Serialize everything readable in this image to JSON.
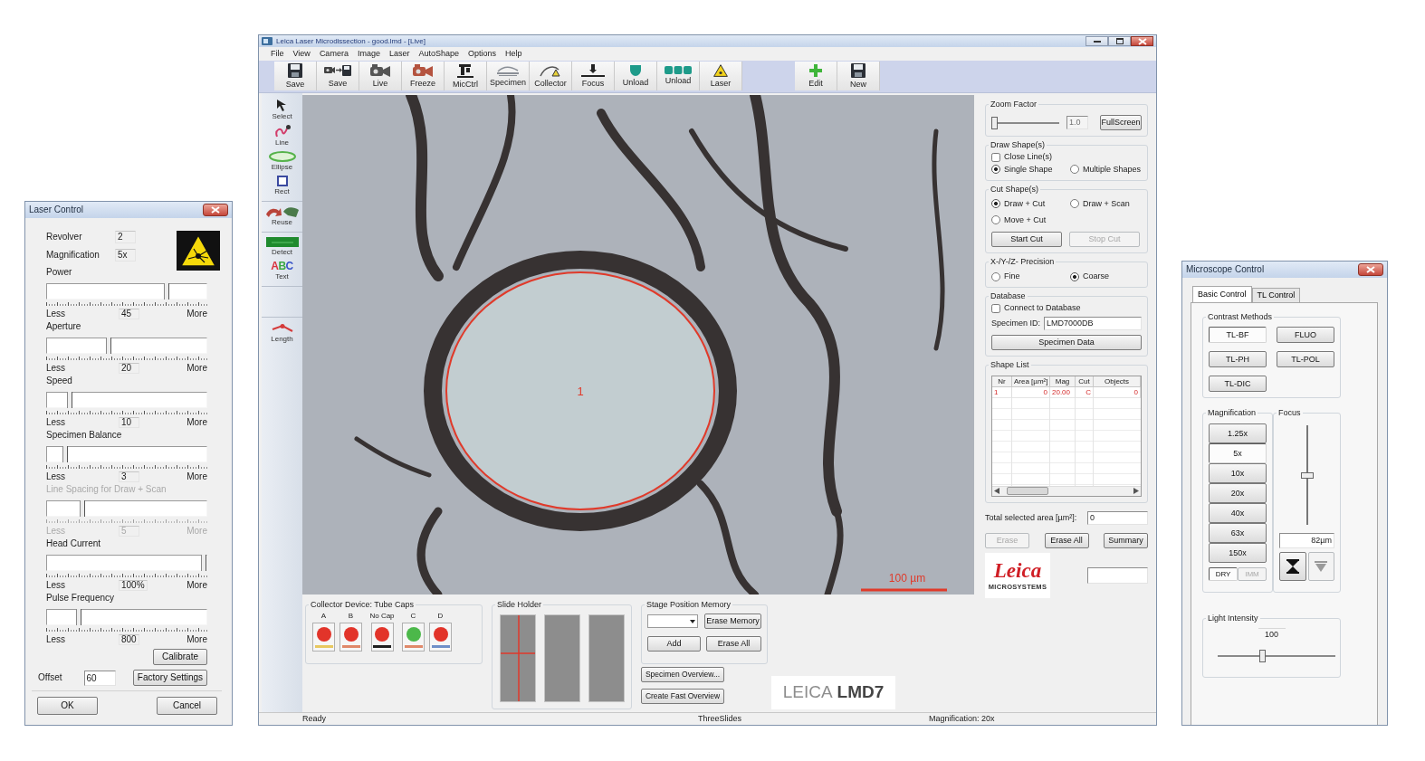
{
  "laser_control": {
    "title": "Laser Control",
    "revolver": {
      "label": "Revolver",
      "value": "2"
    },
    "magnification": {
      "label": "Magnification",
      "value": "5x"
    },
    "sliders": [
      {
        "title": "Power",
        "level": 0.76,
        "value": "45",
        "less": "Less",
        "more": "More",
        "disabled": false
      },
      {
        "title": "Aperture",
        "level": 0.38,
        "value": "20",
        "less": "Less",
        "more": "More",
        "disabled": false
      },
      {
        "title": "Speed",
        "level": 0.13,
        "value": "10",
        "less": "Less",
        "more": "More",
        "disabled": false
      },
      {
        "title": "Specimen Balance",
        "level": 0.1,
        "value": "3",
        "less": "Less",
        "more": "More",
        "disabled": false
      },
      {
        "title": "Line Spacing for Draw + Scan",
        "level": 0.21,
        "value": "5",
        "less": "Less",
        "more": "More",
        "disabled": true
      },
      {
        "title": "Head Current",
        "level": 1,
        "value": "100%",
        "less": "Less",
        "more": "More",
        "disabled": false
      },
      {
        "title": "Pulse Frequency",
        "level": 0.19,
        "value": "800",
        "less": "Less",
        "more": "More",
        "disabled": false
      }
    ],
    "calibrate_button": "Calibrate",
    "offset": {
      "label": "Offset",
      "value": "60"
    },
    "factory_settings_button": "Factory Settings",
    "ok_button": "OK",
    "cancel_button": "Cancel"
  },
  "main_window": {
    "title": "Leica Laser Microdissection - good.lmd - [Live]",
    "menu": [
      "File",
      "View",
      "Camera",
      "Image",
      "Laser",
      "AutoShape",
      "Options",
      "Help"
    ],
    "toolbar_groups": [
      [
        "Save",
        "Save",
        "Live",
        "Freeze",
        "MicCtrl",
        "Specimen",
        "Collector",
        "Focus",
        "Unload",
        "Unload",
        "Laser"
      ],
      [
        "Edit",
        "New"
      ]
    ],
    "tool_groups": [
      [
        {
          "label": "Select"
        },
        {
          "label": "Line"
        },
        {
          "label": "Ellipse"
        },
        {
          "label": "Rect"
        }
      ],
      [
        {
          "label": "Reuse"
        }
      ],
      [
        {
          "label": "Detect"
        },
        {
          "label": "Text",
          "glyph": "ABC"
        }
      ],
      [
        {
          "label": "Length"
        }
      ]
    ],
    "image": {
      "shape_number": "1",
      "scale_bar": "100 µm"
    },
    "zoom_factor": {
      "title": "Zoom Factor",
      "level": 0,
      "value": "1.0",
      "button": "FullScreen"
    },
    "draw_shapes": {
      "title": "Draw Shape(s)",
      "close_lines": {
        "label": "Close Line(s)",
        "checked": false
      },
      "modes": [
        {
          "label": "Single Shape",
          "selected": true
        },
        {
          "label": "Multiple Shapes",
          "selected": false
        }
      ]
    },
    "cut_shapes": {
      "title": "Cut Shape(s)",
      "modes": [
        {
          "label": "Draw + Cut",
          "selected": true
        },
        {
          "label": "Draw + Scan",
          "selected": false
        },
        {
          "label": "Move + Cut",
          "selected": false
        }
      ],
      "buttons": [
        {
          "label": "Start Cut",
          "disabled": false
        },
        {
          "label": "Stop Cut",
          "disabled": true
        }
      ]
    },
    "precision": {
      "title": "X-/Y-/Z- Precision",
      "modes": [
        {
          "label": "Fine",
          "selected": false
        },
        {
          "label": "Coarse",
          "selected": true
        }
      ]
    },
    "database": {
      "title": "Database",
      "connect": {
        "label": "Connect to Database",
        "checked": false
      },
      "specimen_id": {
        "label": "Specimen ID:",
        "value": "LMD7000DB"
      },
      "button": "Specimen Data"
    },
    "shape_list": {
      "title": "Shape List",
      "columns": [
        "Nr",
        "Area [µm²]",
        "Mag",
        "Cut",
        "Objects"
      ],
      "rows": [
        [
          "1",
          "0",
          "20.00",
          "C",
          "0"
        ]
      ]
    },
    "total_area": {
      "label": "Total selected area [µm²]:",
      "value": "0"
    },
    "list_buttons": [
      {
        "label": "Erase",
        "disabled": true
      },
      {
        "label": "Erase All",
        "disabled": false
      },
      {
        "label": "Summary",
        "disabled": false
      }
    ],
    "logo": {
      "name": "Leica",
      "subtitle": "MICROSYSTEMS"
    },
    "collector": {
      "title": "Collector Device: Tube Caps",
      "caps": [
        {
          "label": "A",
          "cap": {
            "color": "#e2342a"
          },
          "tube": {
            "color": "#e8c860"
          }
        },
        {
          "label": "B",
          "cap": {
            "color": "#e2342a"
          },
          "tube": {
            "color": "#e0896a"
          }
        },
        {
          "label": "No Cap",
          "cap": {
            "color": "#e2342a"
          },
          "tube": {
            "color": "#202020"
          }
        },
        {
          "label": "C",
          "cap": {
            "color": "#4cb84a"
          },
          "tube": {
            "color": "#e0896a"
          }
        },
        {
          "label": "D",
          "cap": {
            "color": "#e2342a"
          },
          "tube": {
            "color": "#7090c8"
          }
        }
      ]
    },
    "slide_holder": {
      "title": "Slide Holder",
      "slides": [
        {
          "current": true
        },
        {
          "current": false
        },
        {
          "current": false
        }
      ]
    },
    "stage_memory": {
      "title": "Stage Position Memory",
      "buttons": [
        "Erase Memory",
        "Add",
        "Erase All"
      ]
    },
    "overview_buttons": [
      "Specimen Overview...",
      "Create Fast Overview"
    ],
    "product_logo": {
      "brand": "LEICA",
      "model": "LMD7"
    },
    "status_bar": [
      "Ready",
      "ThreeSlides",
      "Magnification: 20x"
    ]
  },
  "microscope_control": {
    "title": "Microscope Control",
    "tabs": [
      {
        "label": "Basic Control",
        "selected": true
      },
      {
        "label": "TL Control",
        "selected": false
      }
    ],
    "contrast_methods": {
      "title": "Contrast Methods",
      "options": [
        {
          "label": "TL-BF",
          "selected": true
        },
        {
          "label": "FLUO",
          "selected": false
        },
        {
          "label": "TL-PH",
          "selected": false
        },
        {
          "label": "TL-POL",
          "selected": false
        },
        {
          "label": "TL-DIC",
          "selected": false
        }
      ]
    },
    "magnification": {
      "title": "Magnification",
      "objectives": [
        {
          "label": "1.25x",
          "selected": false
        },
        {
          "label": "5x",
          "selected": true
        },
        {
          "label": "10x",
          "selected": false
        },
        {
          "label": "20x",
          "selected": false
        },
        {
          "label": "40x",
          "selected": false
        },
        {
          "label": "63x",
          "selected": false
        },
        {
          "label": "150x",
          "selected": false
        }
      ],
      "immersion": [
        {
          "label": "DRY",
          "selected": true,
          "disabled": false
        },
        {
          "label": "IMM",
          "selected": false,
          "disabled": true
        }
      ]
    },
    "focus": {
      "title": "Focus",
      "level": 0.5,
      "value": "82µm",
      "buttons": [
        {
          "disabled": false
        },
        {
          "disabled": true
        }
      ]
    },
    "light_intensity": {
      "title": "Light Intensity",
      "value": "100",
      "level": 0.37
    }
  }
}
